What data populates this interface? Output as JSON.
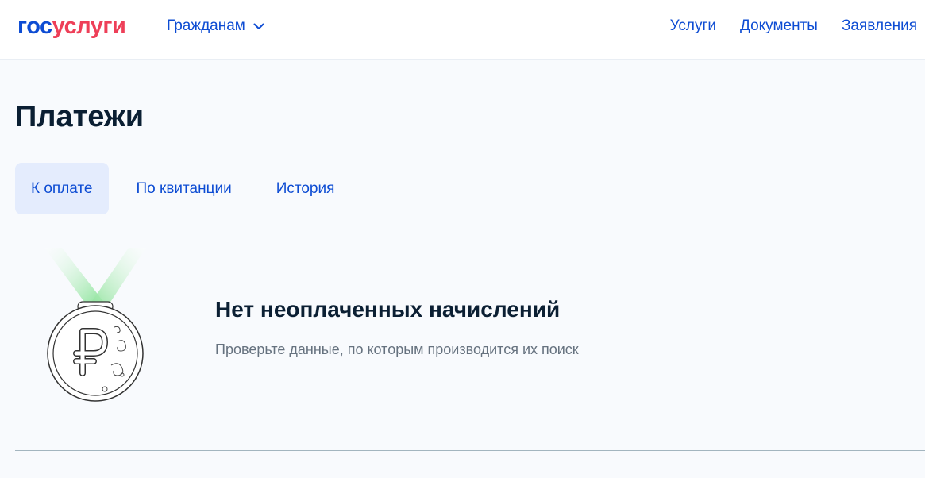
{
  "header": {
    "logo_part1": "гос",
    "logo_part2": "услуги",
    "role_menu_label": "Гражданам",
    "nav": [
      "Услуги",
      "Документы",
      "Заявления"
    ]
  },
  "page": {
    "title": "Платежи",
    "tabs": [
      {
        "label": "К оплате",
        "active": true
      },
      {
        "label": "По квитанции",
        "active": false
      },
      {
        "label": "История",
        "active": false
      }
    ]
  },
  "empty_state": {
    "title": "Нет неоплаченных начислений",
    "text": "Проверьте данные, по которым производится их поиск",
    "illustration": "ruble-medal-icon"
  },
  "colors": {
    "brand_blue": "#0d4cd3",
    "brand_red": "#ee3f58",
    "active_tab_bg": "#e4ecfd",
    "ribbon_green": "#7ee08e"
  }
}
